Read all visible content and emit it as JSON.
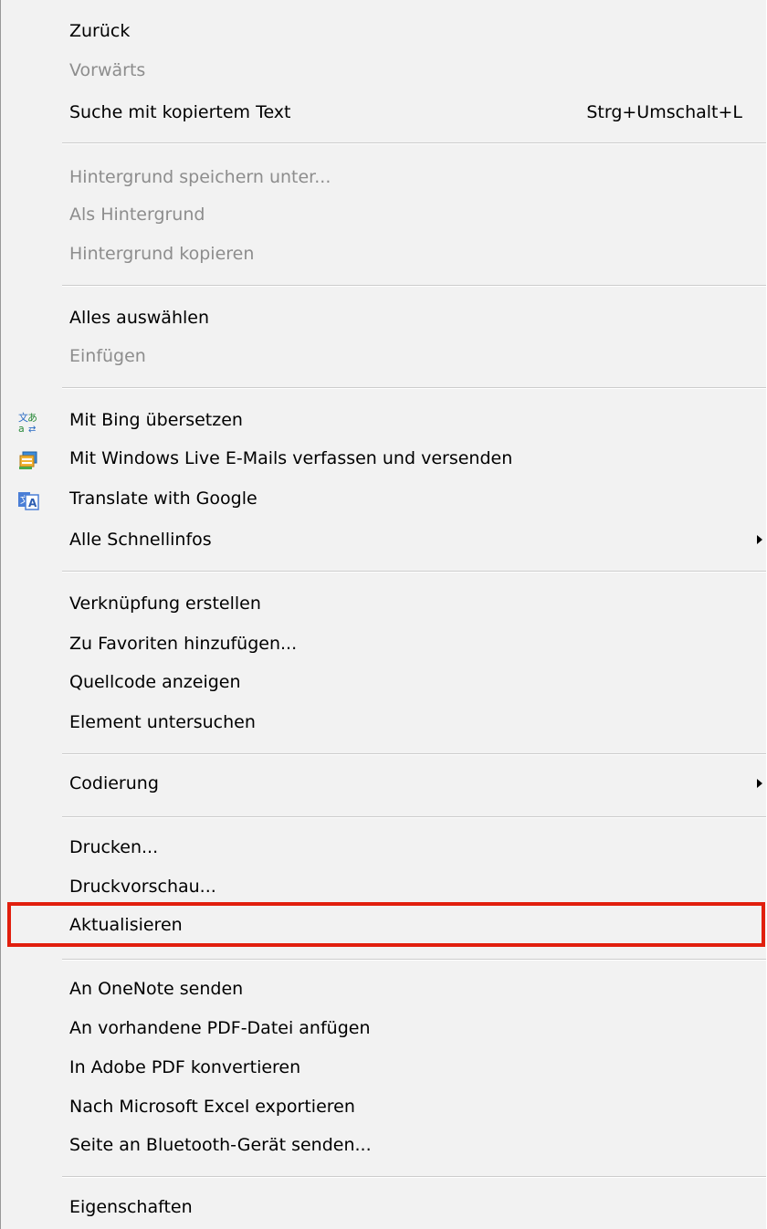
{
  "menu": {
    "group1": {
      "zurueck": "Zurück",
      "vorwaerts": "Vorwärts",
      "suche": "Suche mit kopiertem Text",
      "suche_shortcut": "Strg+Umschalt+L"
    },
    "group2": {
      "hintergrund_speichern": "Hintergrund speichern unter...",
      "als_hintergrund": "Als Hintergrund",
      "hintergrund_kopieren": "Hintergrund kopieren"
    },
    "group3": {
      "alles_auswaehlen": "Alles auswählen",
      "einfuegen": "Einfügen"
    },
    "group4": {
      "bing": "Mit Bing übersetzen",
      "bing_icon": "bing-translate-icon",
      "windows_live": "Mit Windows Live E-Mails verfassen und versenden",
      "windows_live_icon": "windows-live-mail-icon",
      "google": "Translate with Google",
      "google_icon": "google-translate-icon",
      "schnellinfos": "Alle Schnellinfos"
    },
    "group5": {
      "verknuepfung": "Verknüpfung erstellen",
      "favoriten": "Zu Favoriten hinzufügen...",
      "quellcode": "Quellcode anzeigen",
      "element": "Element untersuchen"
    },
    "group6": {
      "codierung": "Codierung"
    },
    "group7": {
      "drucken": "Drucken...",
      "druckvorschau": "Druckvorschau...",
      "aktualisieren": "Aktualisieren"
    },
    "group8": {
      "onenote": "An OneNote senden",
      "pdf_anfuegen": "An vorhandene PDF-Datei anfügen",
      "adobe_pdf": "In Adobe PDF konvertieren",
      "excel": "Nach Microsoft Excel exportieren",
      "bluetooth": "Seite an Bluetooth-Gerät senden..."
    },
    "group9": {
      "eigenschaften": "Eigenschaften"
    },
    "colors": {
      "enabled_text": "#000000",
      "disabled_text": "#8d8d8d",
      "highlight_border": "#e11f0e",
      "background": "#f2f2f2"
    }
  }
}
